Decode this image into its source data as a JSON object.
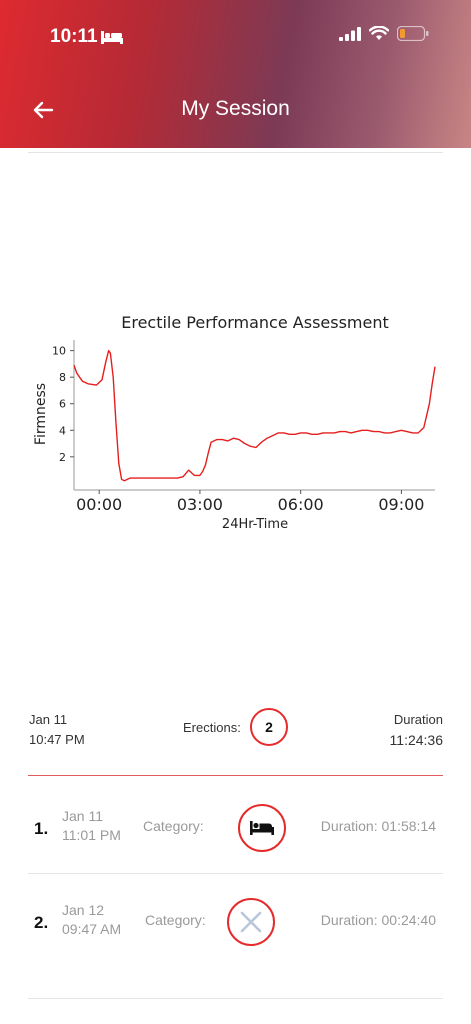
{
  "status": {
    "time": "10:11"
  },
  "header": {
    "title": "My Session"
  },
  "chart_data": {
    "type": "line",
    "title": "Erectile Performance Assessment",
    "xlabel": "24Hr-Time",
    "ylabel": "Firmness",
    "x_ticks": [
      "00:00",
      "03:00",
      "06:00",
      "09:00"
    ],
    "y_ticks": [
      2,
      4,
      6,
      8,
      10
    ],
    "xlim_minutes": [
      -45,
      600
    ],
    "ylim": [
      -0.5,
      10.5
    ],
    "color": "#e61e1e",
    "series": [
      {
        "x": [
          -45,
          -40,
          -30,
          -20,
          -5,
          5,
          12,
          17,
          20,
          25,
          30,
          35,
          40,
          45,
          55,
          60,
          70,
          80,
          90,
          100,
          110,
          120,
          130,
          140,
          150,
          160,
          170,
          180,
          185,
          190,
          195,
          200,
          210,
          220,
          230,
          240,
          250,
          260,
          270,
          280,
          290,
          300,
          310,
          320,
          330,
          340,
          350,
          360,
          370,
          380,
          390,
          400,
          410,
          420,
          430,
          440,
          450,
          460,
          470,
          480,
          490,
          500,
          510,
          520,
          530,
          540,
          550,
          560,
          570,
          580,
          590,
          595,
          600
        ],
        "y": [
          8.9,
          8.3,
          7.7,
          7.5,
          7.4,
          7.8,
          9.2,
          10.0,
          9.8,
          8.0,
          4.5,
          1.5,
          0.3,
          0.2,
          0.4,
          0.4,
          0.4,
          0.4,
          0.4,
          0.4,
          0.4,
          0.4,
          0.4,
          0.4,
          0.5,
          1.0,
          0.6,
          0.6,
          0.9,
          1.4,
          2.3,
          3.1,
          3.3,
          3.3,
          3.2,
          3.4,
          3.3,
          3.0,
          2.8,
          2.7,
          3.1,
          3.4,
          3.6,
          3.8,
          3.8,
          3.7,
          3.7,
          3.8,
          3.8,
          3.7,
          3.7,
          3.8,
          3.8,
          3.8,
          3.9,
          3.9,
          3.8,
          3.9,
          4.0,
          4.0,
          3.9,
          3.9,
          3.8,
          3.8,
          3.9,
          4.0,
          3.9,
          3.8,
          3.8,
          4.2,
          6.0,
          7.5,
          8.8
        ]
      }
    ]
  },
  "summary": {
    "date": "Jan 11",
    "time": "10:47 PM",
    "erections_label": "Erections:",
    "erections_count": "2",
    "duration_label": "Duration",
    "duration_value": "11:24:36"
  },
  "rows": [
    {
      "num": "1.",
      "date": "Jan 11",
      "time": "11:01 PM",
      "category_label": "Category:",
      "category_icon": "bed-icon",
      "duration": "Duration: 01:58:14"
    },
    {
      "num": "2.",
      "date": "Jan 12",
      "time": "09:47 AM",
      "category_label": "Category:",
      "category_icon": "x-icon",
      "duration": "Duration: 00:24:40"
    }
  ]
}
